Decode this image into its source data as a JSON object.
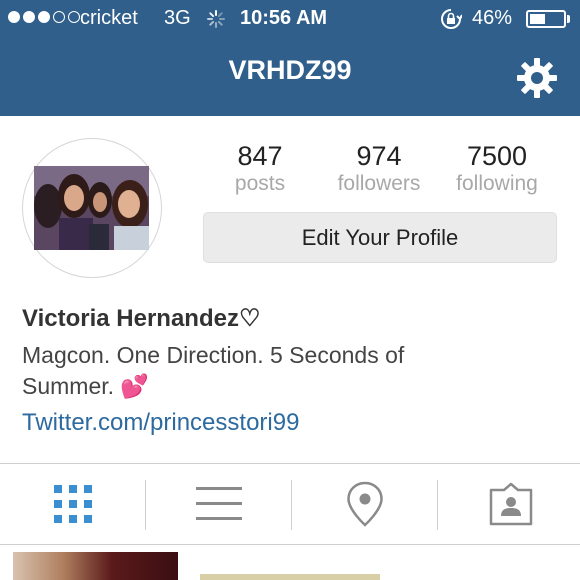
{
  "status_bar": {
    "carrier": "cricket",
    "network": "3G",
    "time": "10:56 AM",
    "battery_percent": "46%",
    "battery_level": 0.46,
    "signal_bars_filled": 3,
    "signal_bars_total": 5
  },
  "header": {
    "username": "VRHDZ99",
    "settings_icon": "gear-icon",
    "background_color": "#2f5f8a"
  },
  "profile": {
    "stats": [
      {
        "number": "847",
        "label": "posts"
      },
      {
        "number": "974",
        "label": "followers"
      },
      {
        "number": "7500",
        "label": "following"
      }
    ],
    "edit_button_label": "Edit Your Profile",
    "full_name": "Victoria Hernandez♡",
    "bio": "Magcon. One Direction. 5 Seconds of Summer. 💕",
    "link": "Twitter.com/princesstori99",
    "link_color": "#2d6a9f"
  },
  "tabs": [
    {
      "icon": "grid-icon",
      "active": true
    },
    {
      "icon": "list-icon",
      "active": false
    },
    {
      "icon": "location-pin-icon",
      "active": false
    },
    {
      "icon": "tagged-person-icon",
      "active": false
    }
  ],
  "colors": {
    "active_tab": "#3b8fd0",
    "inactive_tab": "#8a8a8a"
  }
}
